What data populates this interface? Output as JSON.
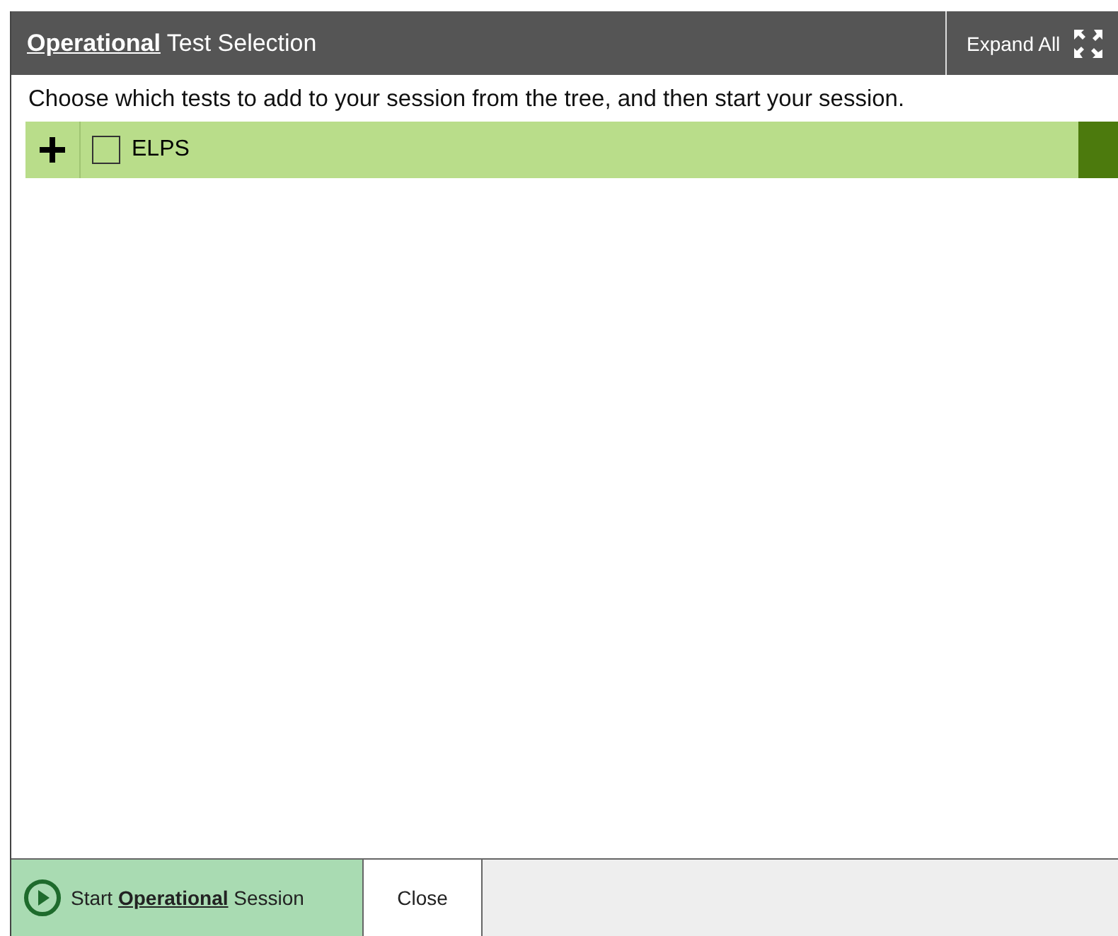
{
  "header": {
    "title_emphasis": "Operational",
    "title_rest": "Test Selection",
    "expand_button": "Expand All"
  },
  "instructions": "Choose which tests to add to your session from the tree, and then start your session.",
  "tree": [
    {
      "label": "ELPS",
      "expanded": false,
      "checked": false
    }
  ],
  "footer": {
    "start_button": {
      "before": "Start",
      "emphasis": "Operational",
      "after": "Session"
    },
    "close_button": "Close"
  }
}
